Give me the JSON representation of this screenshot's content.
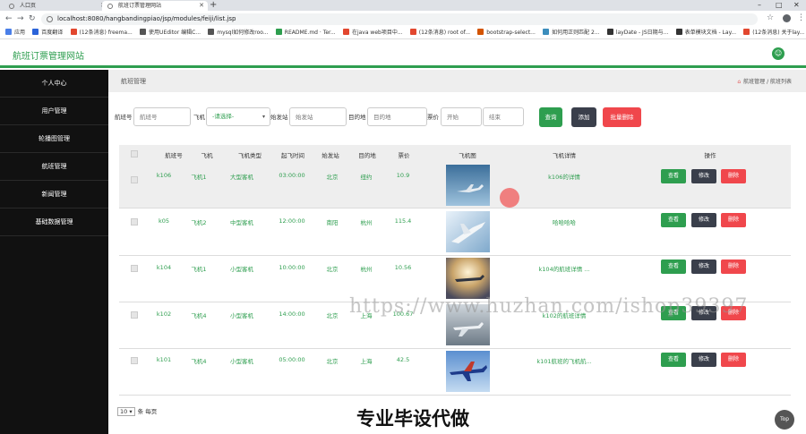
{
  "browser": {
    "tabs": [
      {
        "label": "人口页",
        "active": false
      },
      {
        "label": "航班订票管理网站",
        "active": true
      }
    ],
    "url": "localhost:8080/hangbandingpiao/jsp/modules/feiji/list.jsp",
    "bookmarks": [
      "应用",
      "百度翻译",
      "(12条消息) freema...",
      "使用UEditor 编辑C...",
      "mysql如何修改roo...",
      "README.md · Ter...",
      "在java web项目中...",
      "(12条消息) root of...",
      "bootstrap-select...",
      "如何用正则匹配 2...",
      "layDate - JS日期与...",
      "表单模块文档 - Lay...",
      "(12条消息) 关于lay..."
    ]
  },
  "app": {
    "title": "航班订票管理网站",
    "user_icon": "user-icon",
    "brand_color": "#2e9e4f"
  },
  "sidebar": {
    "items": [
      "个人中心",
      "用户管理",
      "轮播图管理",
      "航班管理",
      "新闻管理",
      "基础数据管理"
    ]
  },
  "breadcrumb": {
    "title": "航班管理",
    "path": "航班管理 / 航班列表"
  },
  "search": {
    "flight_no_label": "航班号",
    "flight_no_placeholder": "航班号",
    "plane_label": "飞机",
    "plane_selected": "-请选择-",
    "departure_label": "始发站",
    "departure_placeholder": "始发站",
    "destination_label": "目的地",
    "destination_placeholder": "目的地",
    "price_label": "票价",
    "price_start_placeholder": "开始",
    "price_end_placeholder": "结束",
    "query_button": "查询",
    "add_button": "添加",
    "batch_delete_button": "批量删除"
  },
  "table": {
    "headers": [
      "航班号",
      "飞机",
      "飞机类型",
      "起飞时间",
      "始发站",
      "目的地",
      "票价",
      "飞机图",
      "飞机详情",
      "操作"
    ],
    "rows": [
      {
        "flight_no": "k106",
        "plane": "飞机1",
        "type": "大型客机",
        "time": "03:00:00",
        "from": "北京",
        "to": "纽约",
        "price": "10.9",
        "detail": "k106的详情"
      },
      {
        "flight_no": "k05",
        "plane": "飞机2",
        "type": "中型客机",
        "time": "12:00:00",
        "from": "南阳",
        "to": "杭州",
        "price": "115.4",
        "detail": "哈哈哈哈"
      },
      {
        "flight_no": "k104",
        "plane": "飞机1",
        "type": "小型客机",
        "time": "10:00:00",
        "from": "北京",
        "to": "杭州",
        "price": "10.56",
        "detail": "k104的航班详情 ..."
      },
      {
        "flight_no": "k102",
        "plane": "飞机4",
        "type": "小型客机",
        "time": "14:00:00",
        "from": "北京",
        "to": "上海",
        "price": "100.67",
        "detail": "k102的航班详情"
      },
      {
        "flight_no": "k101",
        "plane": "飞机4",
        "type": "小型客机",
        "time": "05:00:00",
        "from": "北京",
        "to": "上海",
        "price": "42.5",
        "detail": "k101航班的飞机航..."
      }
    ],
    "actions": {
      "view": "查看",
      "edit": "修改",
      "delete": "删除"
    }
  },
  "pager": {
    "page_size": "10",
    "suffix": "条 每页"
  },
  "overlay": {
    "watermark_url": "https://www.huzhan.com/ishop39397",
    "caption": "专业毕设代做",
    "top_button": "Top"
  }
}
